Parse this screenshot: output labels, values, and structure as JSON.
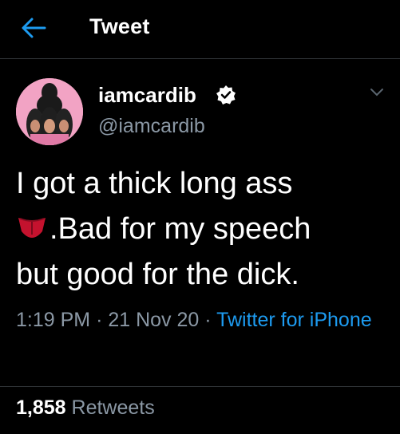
{
  "header": {
    "back_icon": "arrow-left-icon",
    "title": "Tweet"
  },
  "colors": {
    "background": "#000000",
    "accent": "#1d9bf0",
    "secondary_text": "#8b98a5",
    "divider": "#2f3336"
  },
  "tweet": {
    "author": {
      "display_name": "iamcardib",
      "handle": "@iamcardib",
      "verified_icon": "verified-badge-icon",
      "avatar_icon": "profile-avatar"
    },
    "more_icon": "chevron-down-icon",
    "text_line1": "I got a thick long ass",
    "emoji_icon": "tongue-emoji-icon",
    "text_line2": ".Bad for my speech",
    "text_line3": "but good for the dick.",
    "time": "1:19 PM",
    "separator": "·",
    "date": "21 Nov 20",
    "source": "Twitter for iPhone"
  },
  "stats": {
    "retweets_count": "1,858",
    "retweets_label": "Retweets"
  }
}
